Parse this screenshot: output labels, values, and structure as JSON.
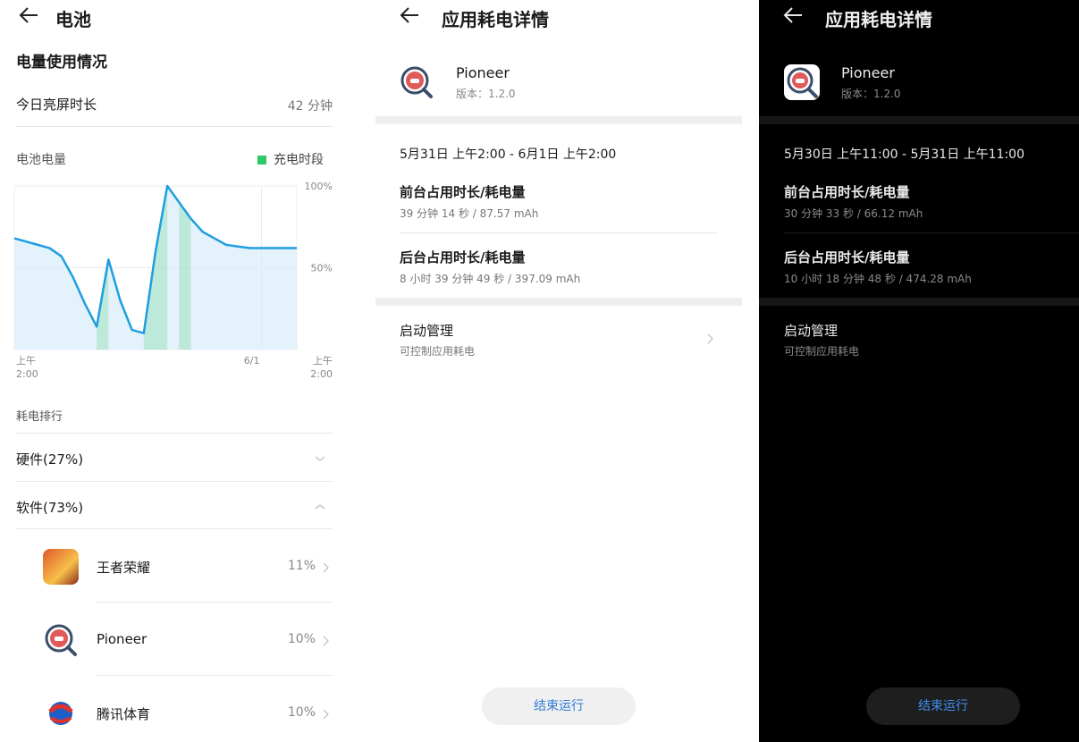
{
  "screen1": {
    "title": "电池",
    "usage_title": "电量使用情况",
    "screen_on_label": "今日亮屏时长",
    "screen_on_value": "42 分钟",
    "battery_level_label": "电池电量",
    "legend_charging": "充电时段",
    "ranking_label": "耗电排行",
    "hardware_label": "硬件(27%)",
    "software_label": "软件(73%)",
    "apps": [
      {
        "name": "王者荣耀",
        "percent": "11%"
      },
      {
        "name": "Pioneer",
        "percent": "10%"
      },
      {
        "name": "腾讯体育",
        "percent": "10%"
      }
    ],
    "colors": {
      "line": "#1e9ee0",
      "fill": "#d8ecfa",
      "charging": "#2ec866"
    }
  },
  "chart_data": {
    "type": "area",
    "x_tick_labels": [
      {
        "top": "上午",
        "bottom": "2:00"
      },
      {
        "top": "6/1",
        "bottom": ""
      },
      {
        "top": "上午",
        "bottom": "2:00"
      }
    ],
    "y_tick_labels": [
      "100%",
      "50%"
    ],
    "ylim": [
      0,
      100
    ],
    "x": [
      0,
      1,
      2,
      3,
      4,
      5,
      6,
      7,
      8,
      9,
      10,
      11,
      12,
      13,
      14,
      15,
      16,
      17,
      18,
      19,
      20,
      21,
      22,
      23,
      24
    ],
    "series": [
      {
        "values": [
          68,
          66,
          64,
          62,
          57,
          44,
          28,
          14,
          55,
          30,
          12,
          10,
          60,
          100,
          90,
          80,
          72,
          68,
          64,
          63,
          62,
          62,
          62,
          62,
          62
        ]
      }
    ],
    "charging_intervals": [
      [
        7,
        8
      ],
      [
        11,
        13
      ],
      [
        14,
        15
      ]
    ]
  },
  "screen2": {
    "title": "应用耗电详情",
    "app_name": "Pioneer",
    "version": "版本：1.2.0",
    "range": "5月31日 上午2:00 - 6月1日 上午2:00",
    "foreground_label": "前台占用时长/耗电量",
    "foreground_value": "39 分钟 14 秒 / 87.57 mAh",
    "background_label": "后台占用时长/耗电量",
    "background_value": "8 小时 39 分钟 49 秒 / 397.09 mAh",
    "launch_label": "启动管理",
    "launch_sub": "可控制应用耗电",
    "end_button": "结束运行"
  },
  "screen3": {
    "title": "应用耗电详情",
    "app_name": "Pioneer",
    "version": "版本：1.2.0",
    "range": "5月30日 上午11:00 - 5月31日 上午11:00",
    "foreground_label": "前台占用时长/耗电量",
    "foreground_value": "30 分钟 33 秒 / 66.12 mAh",
    "background_label": "后台占用时长/耗电量",
    "background_value": "10 小时 18 分钟 48 秒 / 474.28 mAh",
    "launch_label": "启动管理",
    "launch_sub": "可控制应用耗电",
    "end_button": "结束运行"
  }
}
